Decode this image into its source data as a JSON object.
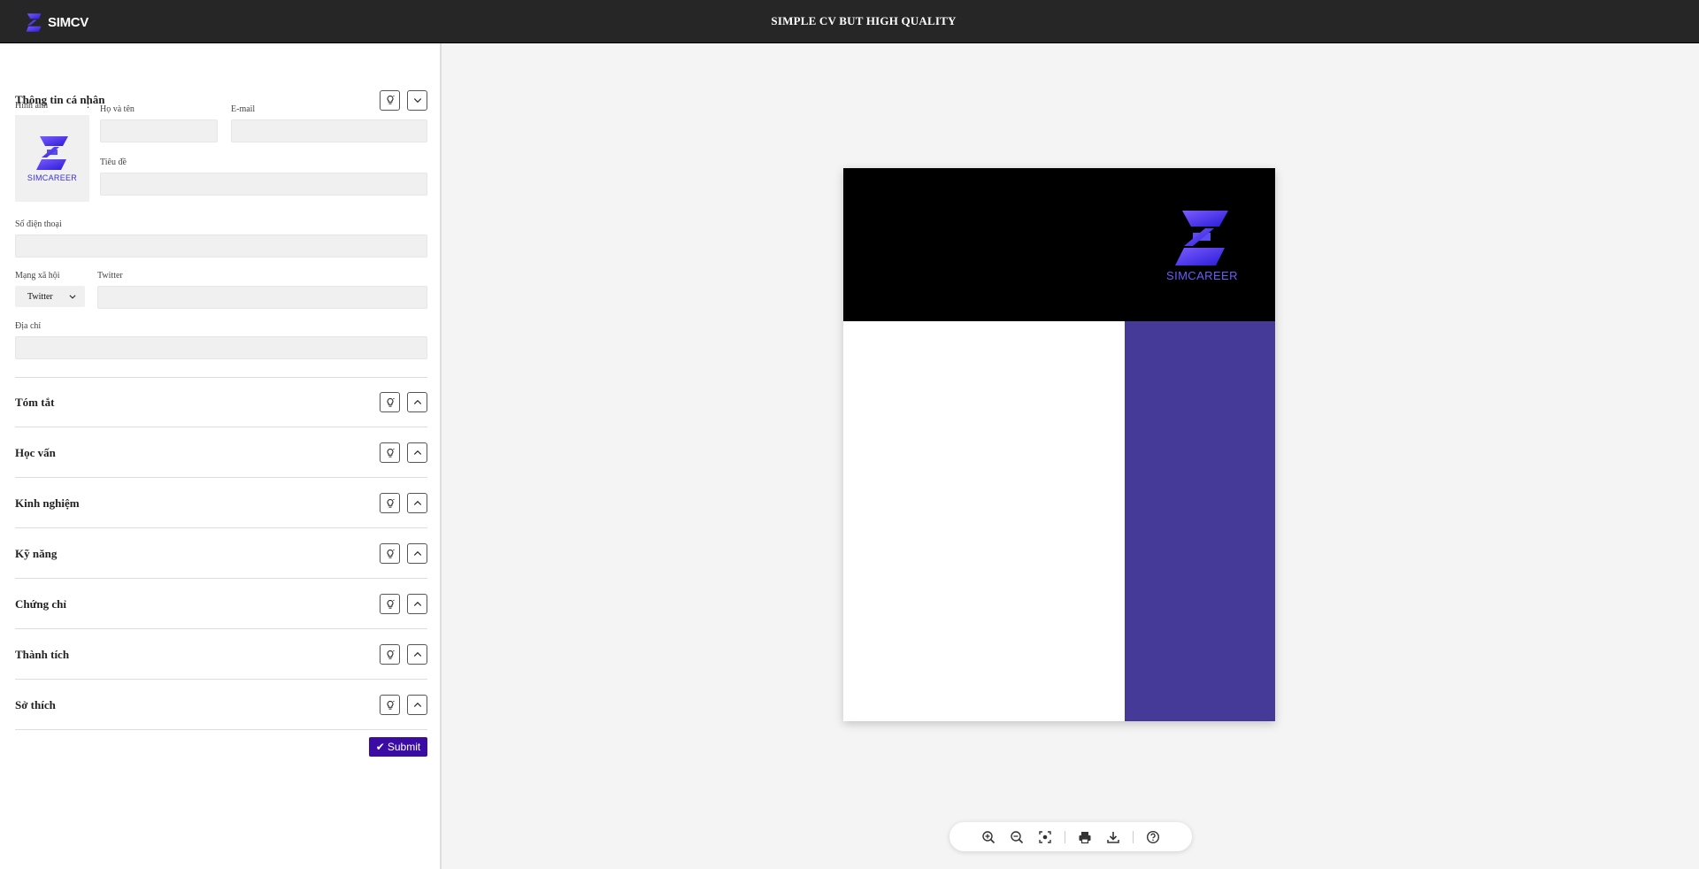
{
  "header": {
    "brand_name": "SIMCV",
    "title": "SIMPLE CV BUT HIGH QUALITY"
  },
  "personal": {
    "title": "Thông tin cá nhân",
    "photo_label": "Hình ảnh",
    "photo_caption": "SIMCAREER",
    "name_label": "Họ và tên",
    "name_value": "",
    "email_label": "E-mail",
    "email_value": "",
    "headline_label": "Tiêu đề",
    "headline_value": "",
    "phone_label": "Số điện thoại",
    "phone_value": "",
    "social_label": "Mạng xã hội",
    "social_selected": "Twitter",
    "social_field_label": "Twitter",
    "social_value": "",
    "address_label": "Địa chỉ",
    "address_value": ""
  },
  "sections": [
    {
      "title": "Tóm tắt"
    },
    {
      "title": "Học vấn"
    },
    {
      "title": "Kinh nghiệm"
    },
    {
      "title": "Kỹ năng"
    },
    {
      "title": "Chứng chỉ"
    },
    {
      "title": "Thành tích"
    },
    {
      "title": "Sở thích"
    }
  ],
  "submit_label": "Submit",
  "preview": {
    "logo_text": "SIMCAREER",
    "header_color": "#000000",
    "sidebar_color": "#463a99"
  },
  "toolbar": {
    "buttons": [
      "zoom-in-icon",
      "zoom-out-icon",
      "fit-screen-icon",
      "print-icon",
      "download-icon",
      "help-icon"
    ]
  },
  "colors": {
    "accent": "#3a0ca3",
    "topbar": "#262626"
  }
}
